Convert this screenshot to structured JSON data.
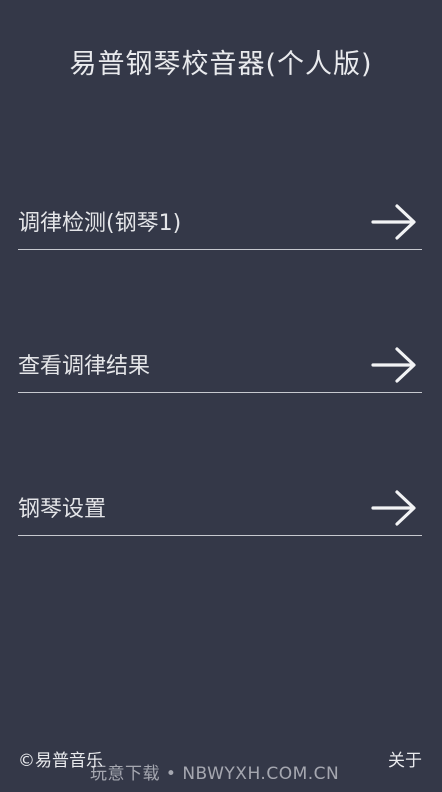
{
  "header": {
    "title": "易普钢琴校音器(个人版)"
  },
  "menu": {
    "items": [
      {
        "label": "调律检测(钢琴1)",
        "icon": "arrow-right-icon"
      },
      {
        "label": "查看调律结果",
        "icon": "arrow-right-icon"
      },
      {
        "label": "钢琴设置",
        "icon": "arrow-right-icon"
      }
    ]
  },
  "footer": {
    "copyright": "©易普音乐",
    "about_label": "关于"
  },
  "watermark": {
    "text": "玩意下载 • NBWYXH.COM.CN"
  },
  "colors": {
    "background": "#343848",
    "text": "#e6e7ea",
    "divider": "#c7c9cf"
  }
}
